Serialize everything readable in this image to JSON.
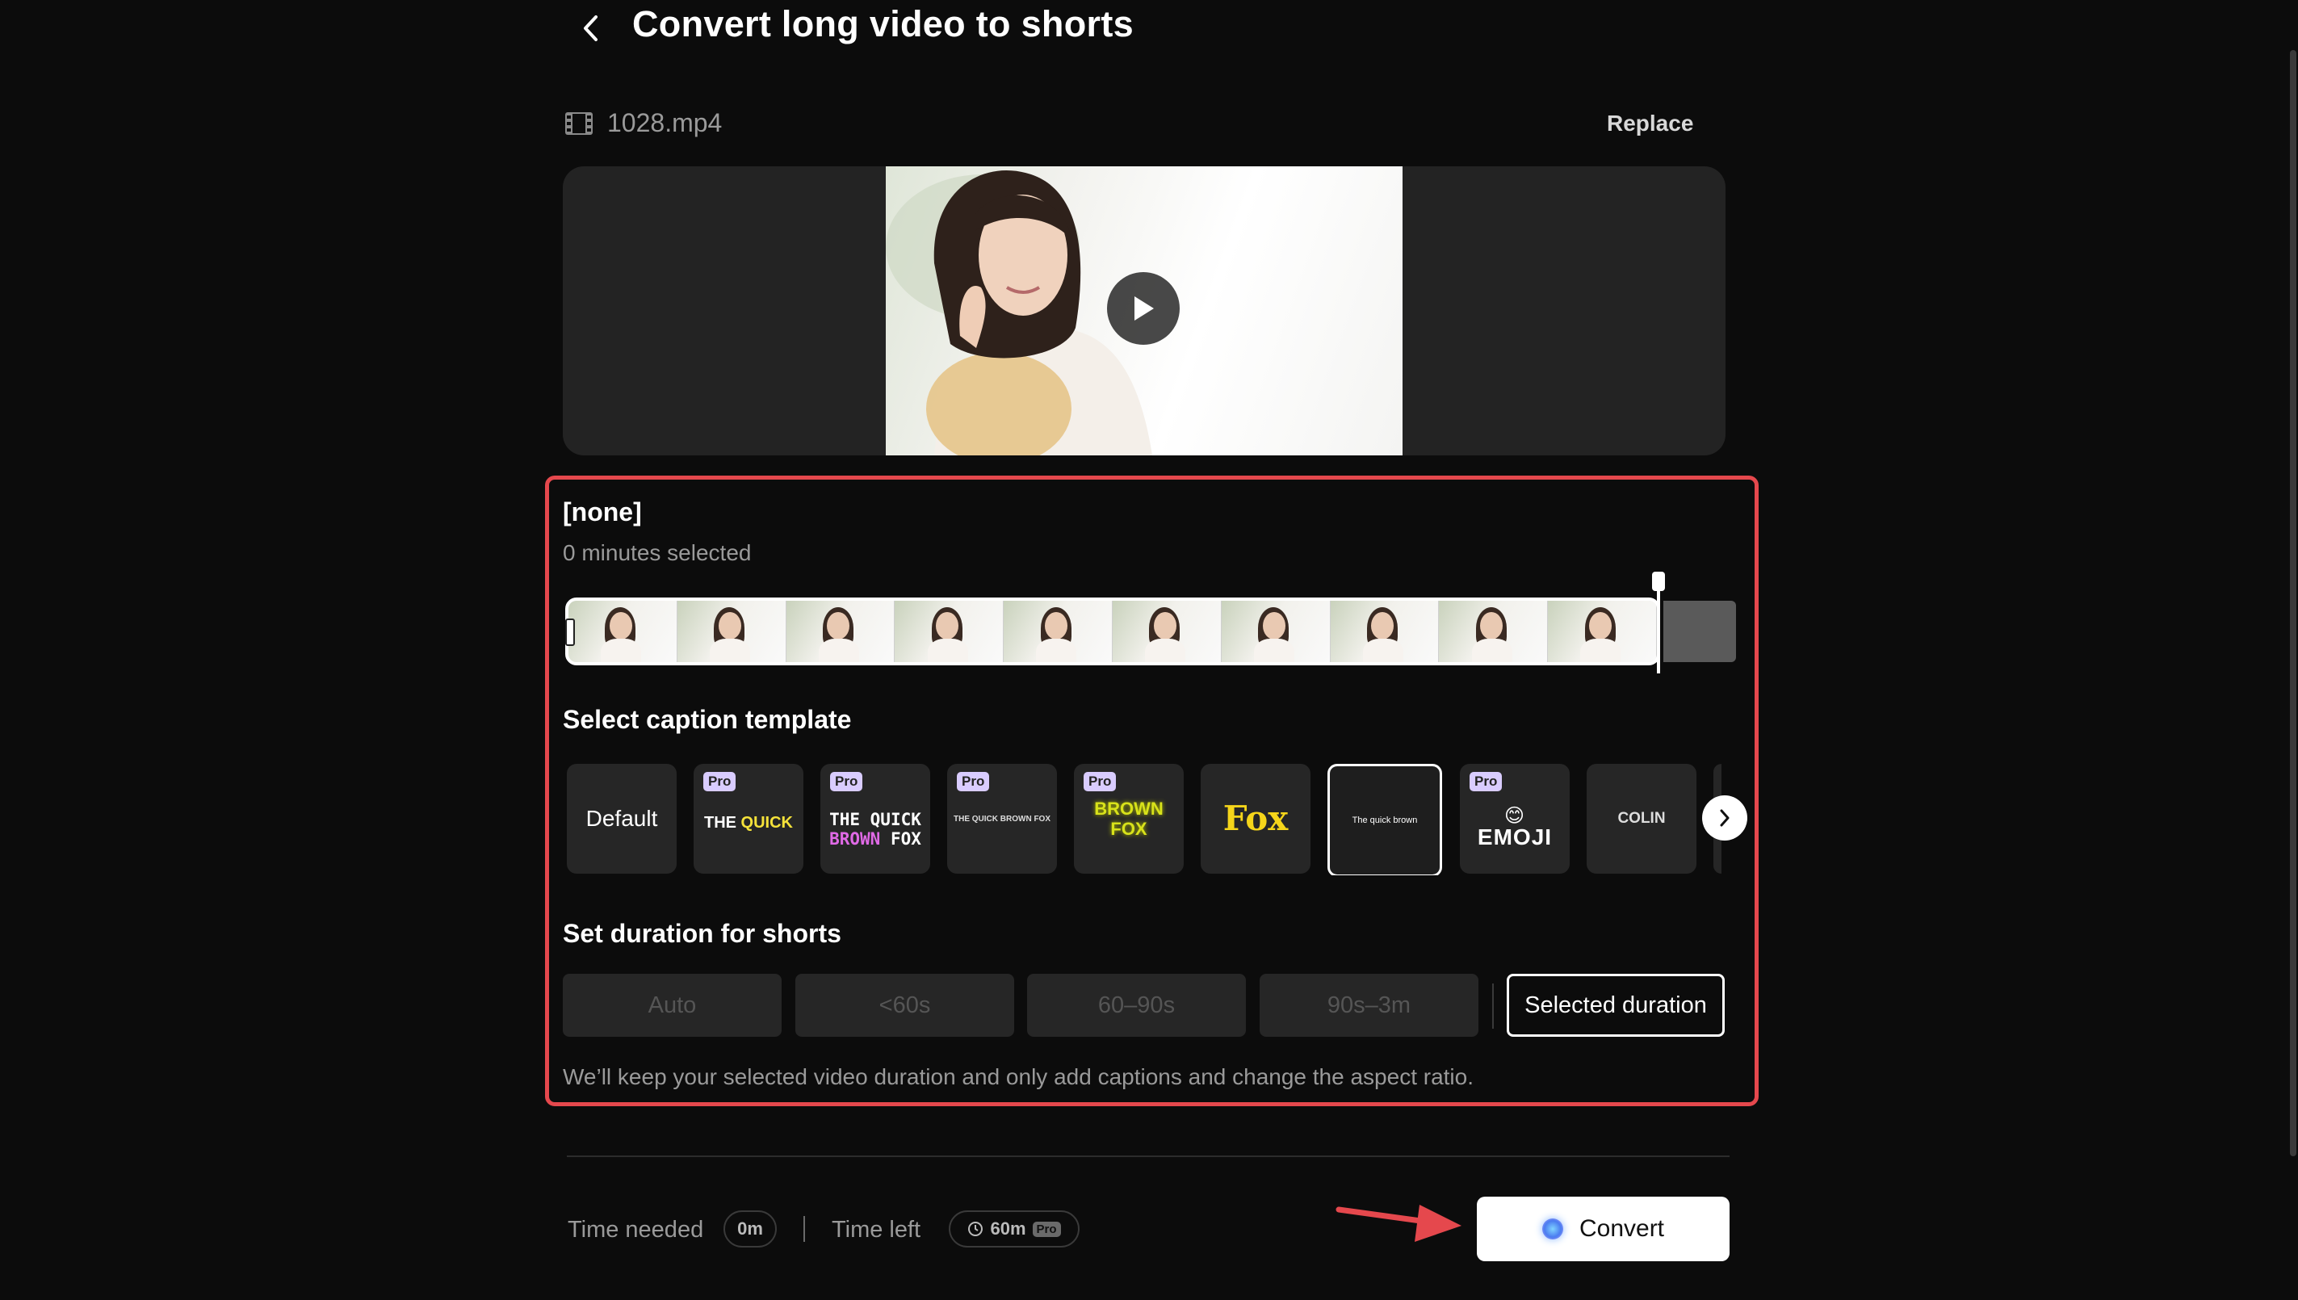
{
  "header": {
    "title": "Convert long video to shorts"
  },
  "file": {
    "name": "1028.mp4",
    "replace_label": "Replace"
  },
  "clip": {
    "name": "[none]",
    "minutes_selected": "0 minutes selected"
  },
  "captions": {
    "heading": "Select caption template",
    "templates": [
      {
        "label": "Default",
        "pro": false
      },
      {
        "label": "THE QUICK",
        "pro": true
      },
      {
        "label": "THE QUICK BROWN FOX",
        "pro": true
      },
      {
        "label": "THE QUICK BROWN FOX",
        "pro": true
      },
      {
        "label": "BROWN FOX",
        "pro": true
      },
      {
        "label": "Fox",
        "pro": false
      },
      {
        "label": "The quick brown",
        "pro": false,
        "selected": true
      },
      {
        "label": "EMOJI",
        "pro": true
      },
      {
        "label": "COLIN",
        "pro": false
      }
    ],
    "pro_badge": "Pro"
  },
  "duration": {
    "heading": "Set duration for shorts",
    "options": [
      "Auto",
      "<60s",
      "60–90s",
      "90s–3m"
    ],
    "selected_label": "Selected duration",
    "note": "We’ll keep your selected video duration and only add captions and change the aspect ratio."
  },
  "footer": {
    "time_needed_label": "Time needed",
    "time_needed_value": "0m",
    "time_left_label": "Time left",
    "time_left_value": "60m",
    "time_left_badge": "Pro",
    "convert_label": "Convert"
  },
  "colors": {
    "highlight": "#e5484d",
    "pro_badge": "#d9ccff",
    "arrow": "#e5484d"
  }
}
